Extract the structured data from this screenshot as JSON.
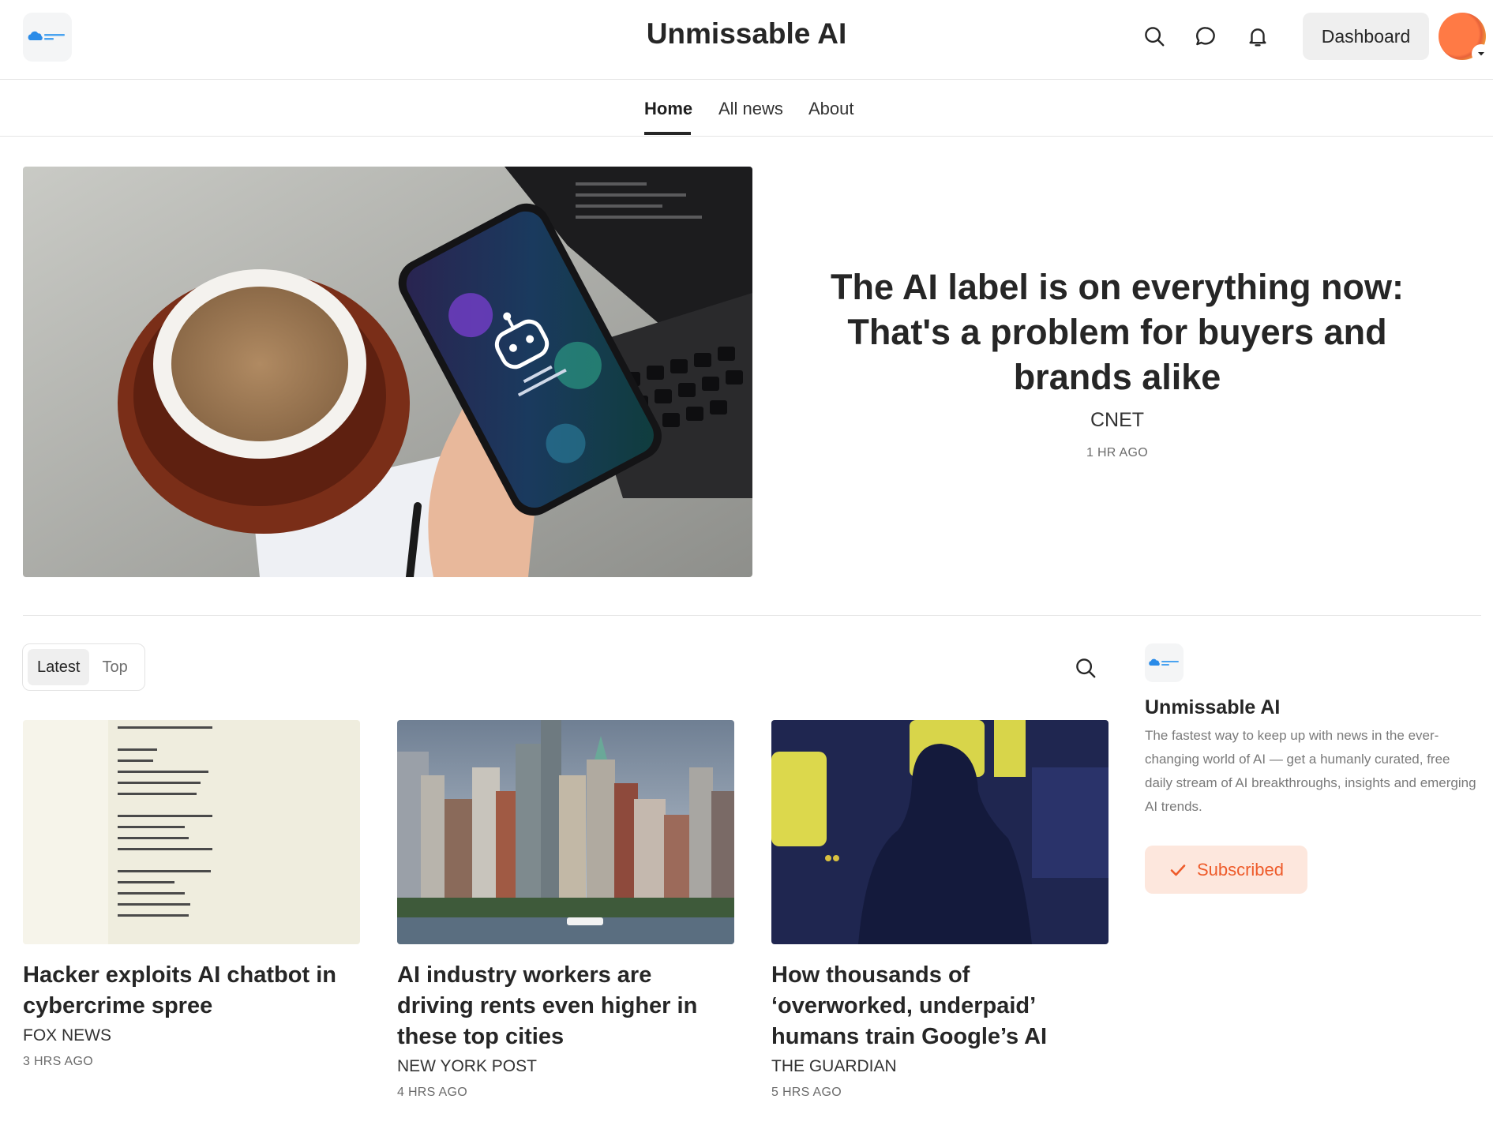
{
  "header": {
    "logo_icon": "cloud-logo-icon",
    "site_title": "Unmissable AI",
    "icons": [
      "search-icon",
      "chat-bubble-icon",
      "bell-icon"
    ],
    "dashboard_label": "Dashboard",
    "avatar": "user-avatar"
  },
  "nav": {
    "items": [
      {
        "label": "Home",
        "active": true
      },
      {
        "label": "All news",
        "active": false
      },
      {
        "label": "About",
        "active": false
      }
    ]
  },
  "hero": {
    "image": "phone-ai-chatbot-coffee-photo",
    "title": "The AI label is on everything now: That's a problem for buyers and brands alike",
    "source": "CNET",
    "time": "1 HR AGO"
  },
  "feed": {
    "tabs": [
      {
        "label": "Latest",
        "active": true
      },
      {
        "label": "Top",
        "active": false
      }
    ],
    "search_icon": "search-icon",
    "cards": [
      {
        "image": "document-profit-plan-photo",
        "title": "Hacker exploits AI chatbot in cybercrime spree",
        "source": "FOX NEWS",
        "time": "3 HRS AGO"
      },
      {
        "image": "city-skyline-photo",
        "title": "AI industry workers are driving rents even higher in these top cities",
        "source": "NEW YORK POST",
        "time": "4 HRS AGO"
      },
      {
        "image": "silhouette-at-window-illustration",
        "title": "How thousands of ‘overworked, underpaid’ humans train Google’s AI",
        "source": "THE GUARDIAN",
        "time": "5 HRS AGO"
      }
    ]
  },
  "sidebar": {
    "name": "Unmissable AI",
    "description": "The fastest way to keep up with news in the ever-changing world of AI — get a humanly curated, free daily stream of AI breakthroughs, insights and emerging AI trends.",
    "subscribe_label": "Subscribed",
    "accent_color": "#ee5b2a"
  }
}
